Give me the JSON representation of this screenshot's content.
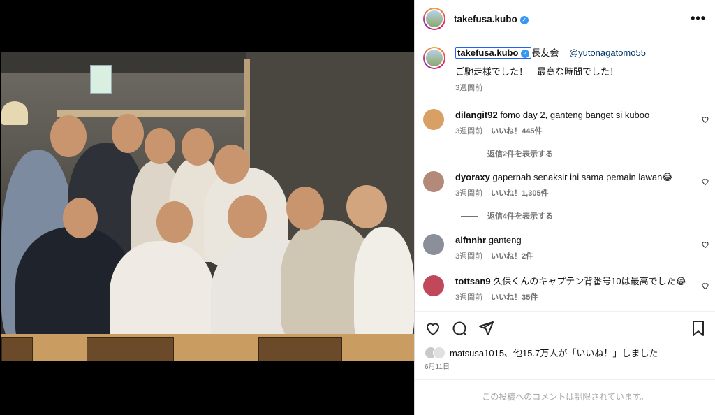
{
  "header": {
    "username": "takefusa.kubo",
    "more_icon": "more-horizontal-icon"
  },
  "caption": {
    "username": "takefusa.kubo",
    "group_text": "長友会",
    "mention": "@yutonagatomo55",
    "text": "ご馳走様でした！　最高な時間でした！",
    "time": "3週間前"
  },
  "comments": [
    {
      "username": "dilangit92",
      "text": "fomo day 2, ganteng banget si kuboo",
      "time": "3週間前",
      "likes": "いいね！445件",
      "replies": "返信2件を表示する",
      "avatar_color": "#d9a066"
    },
    {
      "username": "dyoraxy",
      "text": "gapernah senaksir ini sama pemain lawan😂",
      "time": "3週間前",
      "likes": "いいね！1,305件",
      "replies": "返信4件を表示する",
      "avatar_color": "#b38a7a"
    },
    {
      "username": "alfnnhr",
      "text": "ganteng",
      "time": "3週間前",
      "likes": "いいね！2件",
      "replies": "",
      "avatar_color": "#8a8f9a"
    },
    {
      "username": "tottsan9",
      "text": "久保くんのキャプテン背番号10は最高でした😂",
      "time": "3週間前",
      "likes": "いいね！35件",
      "replies": "",
      "avatar_color": "#c0485a"
    }
  ],
  "likes_summary": "matsusa1015、他15.7万人が「いいね！」しました",
  "post_date": "6月11日",
  "comments_restricted": "この投稿へのコメントは制限されています。",
  "colors": {
    "verified": "#3897f0",
    "link": "#00376b",
    "muted": "#737373"
  }
}
